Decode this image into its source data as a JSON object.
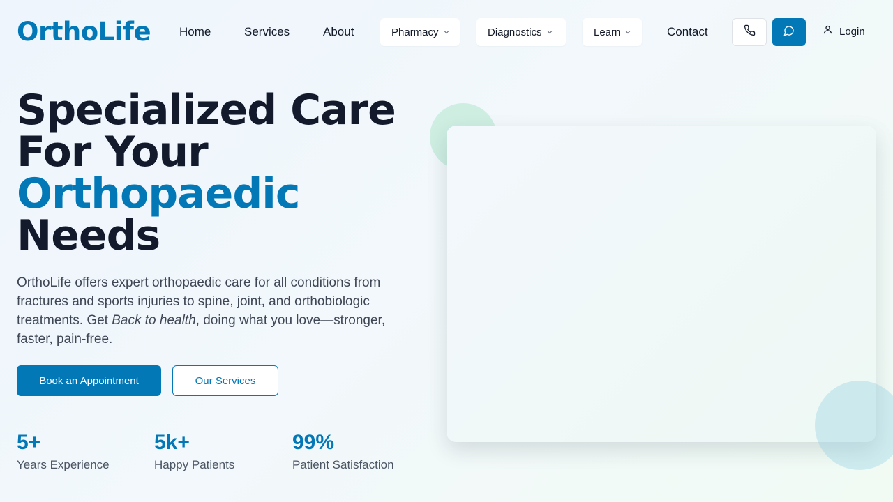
{
  "brand": {
    "logo_text": "OrthoLife"
  },
  "nav": {
    "home": "Home",
    "services": "Services",
    "about": "About",
    "pharmacy": "Pharmacy",
    "diagnostics": "Diagnostics",
    "learn": "Learn",
    "contact": "Contact",
    "login": "Login"
  },
  "icons": {
    "phone": "phone-icon",
    "chat": "chat-bubble-icon",
    "user": "user-icon",
    "chevron": "chevron-down-icon"
  },
  "hero": {
    "title_line1": "Specialized Care",
    "title_line2": "For Your",
    "title_accent": "Orthopaedic",
    "title_line4": "Needs",
    "desc_part1": "OrthoLife offers expert orthopaedic care for all conditions from fractures and sports injuries to spine, joint, and orthobiologic treatments. Get ",
    "desc_emphasis": "Back to health",
    "desc_part2": ", doing what you love—stronger, faster, pain-free.",
    "primary_button": "Book an Appointment",
    "secondary_button": "Our Services"
  },
  "stats": [
    {
      "value": "5+",
      "label": "Years Experience"
    },
    {
      "value": "5k+",
      "label": "Happy Patients"
    },
    {
      "value": "99%",
      "label": "Patient Satisfaction"
    }
  ],
  "colors": {
    "brand_blue": "#0378b7",
    "heading_dark": "#121a2c",
    "text_gray": "#3f4654"
  }
}
